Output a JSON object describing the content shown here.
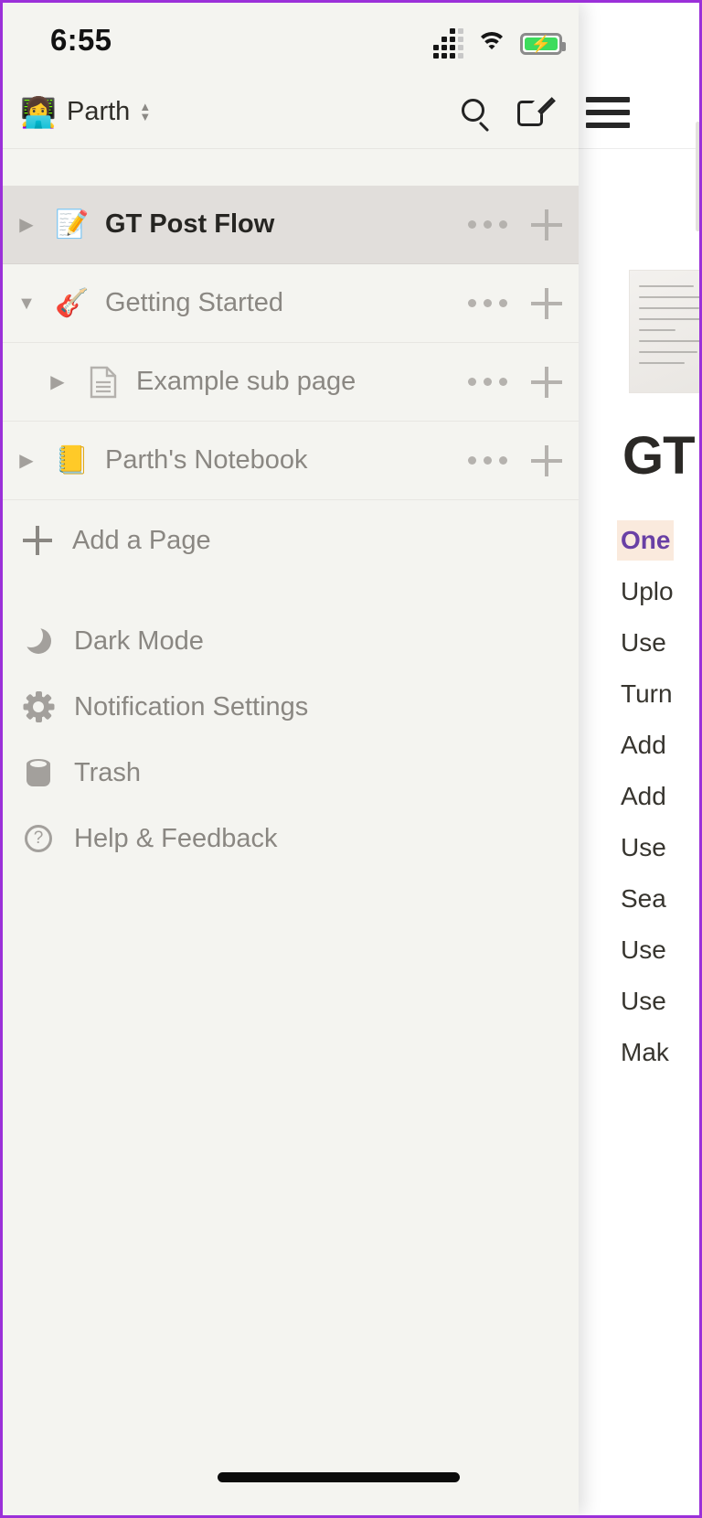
{
  "status_bar": {
    "time": "6:55",
    "cellular_icon": "cellular-signal-icon",
    "wifi_icon": "wifi-icon",
    "battery_icon": "battery-charging-icon",
    "battery_charging": true,
    "battery_color": "#3ddc5c"
  },
  "workspace_header": {
    "avatar_emoji": "👩‍💻",
    "name": "Parth",
    "switcher_icon": "chevron-updown-icon",
    "search_icon": "search-icon",
    "compose_icon": "compose-icon"
  },
  "pages": [
    {
      "emoji": "📝",
      "label": "GT Post Flow",
      "selected": true,
      "expanded": false,
      "nested": false,
      "caret": "▶",
      "more_icon": "more-options-icon",
      "add_icon": "add-subpage-icon"
    },
    {
      "emoji": "🎸",
      "label": "Getting Started",
      "selected": false,
      "expanded": true,
      "nested": false,
      "caret": "▼",
      "more_icon": "more-options-icon",
      "add_icon": "add-subpage-icon"
    },
    {
      "emoji": "",
      "label": "Example sub page",
      "selected": false,
      "expanded": false,
      "nested": true,
      "caret": "▶",
      "more_icon": "more-options-icon",
      "add_icon": "add-subpage-icon"
    },
    {
      "emoji": "📒",
      "label": "Parth's Notebook",
      "selected": false,
      "expanded": false,
      "nested": false,
      "caret": "▶",
      "more_icon": "more-options-icon",
      "add_icon": "add-subpage-icon"
    }
  ],
  "add_page": {
    "label": "Add a Page",
    "icon": "plus-icon"
  },
  "utility_menu": [
    {
      "label": "Dark Mode",
      "icon": "moon-icon"
    },
    {
      "label": "Notification Settings",
      "icon": "gear-icon"
    },
    {
      "label": "Trash",
      "icon": "trash-icon"
    },
    {
      "label": "Help & Feedback",
      "icon": "question-circle-icon"
    }
  ],
  "page_panel": {
    "menu_icon": "hamburger-menu-icon",
    "cover_icon": "handwritten-note-cover",
    "title": "GT Post Flow",
    "highlight_color": "#6940a5",
    "highlight_bg": "#faeadd",
    "items": [
      "One",
      "Uplo",
      "Use",
      "Turn",
      "Add",
      "Add",
      "Use",
      "Sea",
      "Use",
      "Use",
      "Mak"
    ]
  },
  "home_indicator": "home-indicator"
}
